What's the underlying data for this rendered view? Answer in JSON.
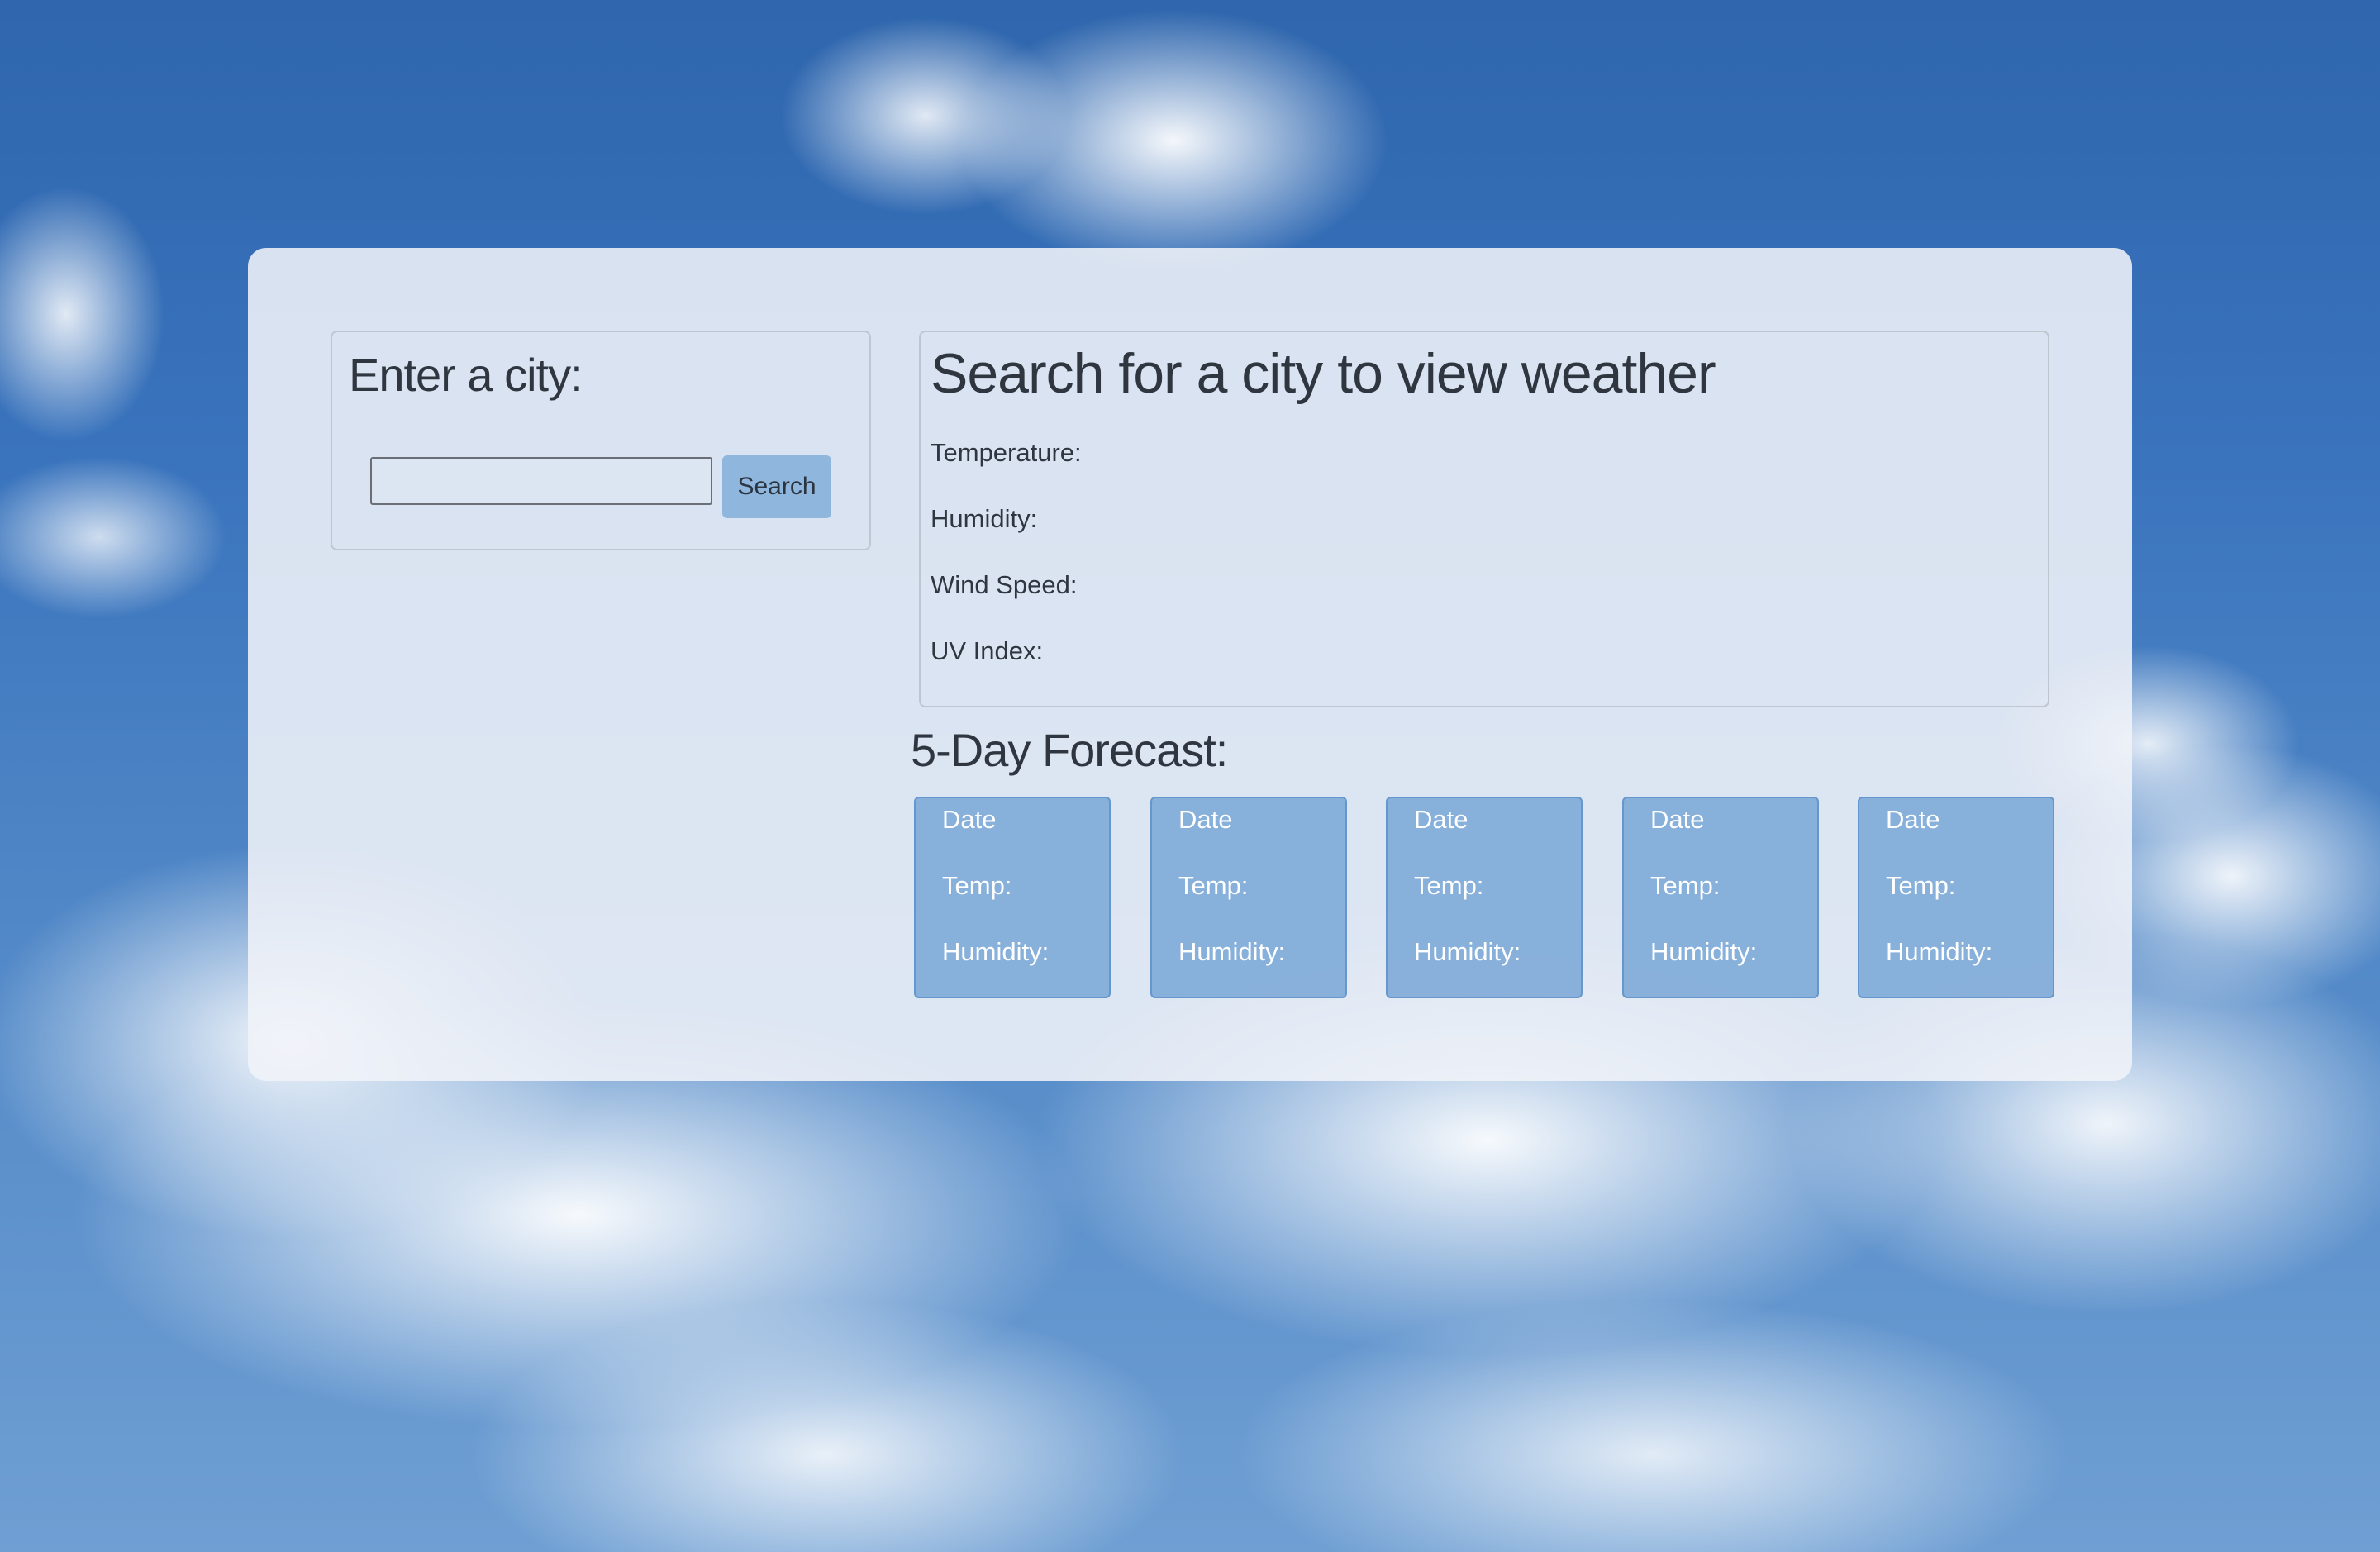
{
  "search": {
    "title": "Enter a city:",
    "input_value": "",
    "button_label": "Search"
  },
  "weather": {
    "title": "Search for a city to view weather",
    "temperature_label": "Temperature:",
    "humidity_label": "Humidity:",
    "wind_speed_label": "Wind Speed:",
    "uv_index_label": "UV Index:"
  },
  "forecast": {
    "title": "5-Day Forecast:",
    "days": [
      {
        "date": "Date",
        "temp": "Temp:",
        "humidity": "Humidity:"
      },
      {
        "date": "Date",
        "temp": "Temp:",
        "humidity": "Humidity:"
      },
      {
        "date": "Date",
        "temp": "Temp:",
        "humidity": "Humidity:"
      },
      {
        "date": "Date",
        "temp": "Temp:",
        "humidity": "Humidity:"
      },
      {
        "date": "Date",
        "temp": "Temp:",
        "humidity": "Humidity:"
      }
    ]
  }
}
